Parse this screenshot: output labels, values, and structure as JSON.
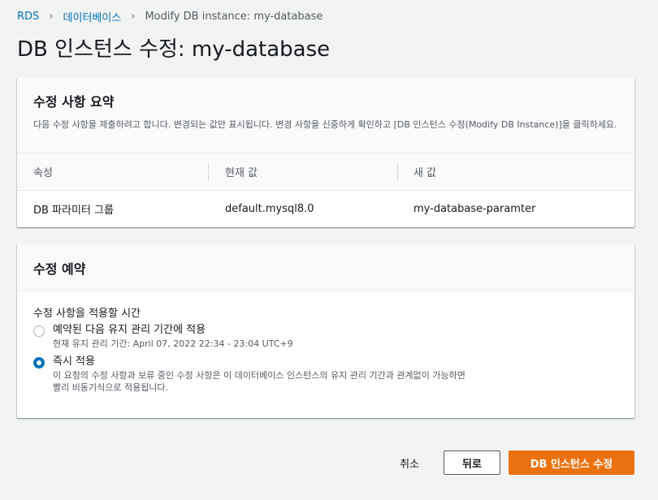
{
  "breadcrumb": {
    "items": [
      "RDS",
      "데이터베이스"
    ],
    "current": "Modify DB instance: my-database"
  },
  "page": {
    "title": "DB 인스턴스 수정: my-database"
  },
  "summary": {
    "title": "수정 사항 요약",
    "description": "다음 수정 사항을 제출하려고 합니다. 변경되는 값만 표시됩니다. 변경 사항을 신중하게 확인하고 [DB 인스턴스 수정(Modify DB Instance)]을 클릭하세요.",
    "columns": [
      "속성",
      "현재 값",
      "새 값"
    ],
    "rows": [
      {
        "attribute": "DB 파라미터 그룹",
        "current": "default.mysql8.0",
        "new": "my-database-paramter"
      }
    ]
  },
  "schedule": {
    "title": "수정 예약",
    "group_label": "수정 사항을 적용할 시간",
    "options": [
      {
        "label": "예약된 다음 유지 관리 기간에 적용",
        "description": "현재 유지 관리 기간: April 07, 2022 22:34 - 23:04 UTC+9",
        "selected": false
      },
      {
        "label": "즉시 적용",
        "description": "이 요청의 수정 사항과 보류 중인 수정 사항은 이 데이터베이스 인스턴스의 유지 관리 기간과 관계없이 가능하면 빨리 비동기식으로 적용됩니다.",
        "selected": true
      }
    ]
  },
  "actions": {
    "cancel": "취소",
    "back": "뒤로",
    "submit": "DB 인스턴스 수정"
  },
  "colors": {
    "link": "#0073bb",
    "primary": "#ec7211",
    "background": "#f2f3f3"
  }
}
